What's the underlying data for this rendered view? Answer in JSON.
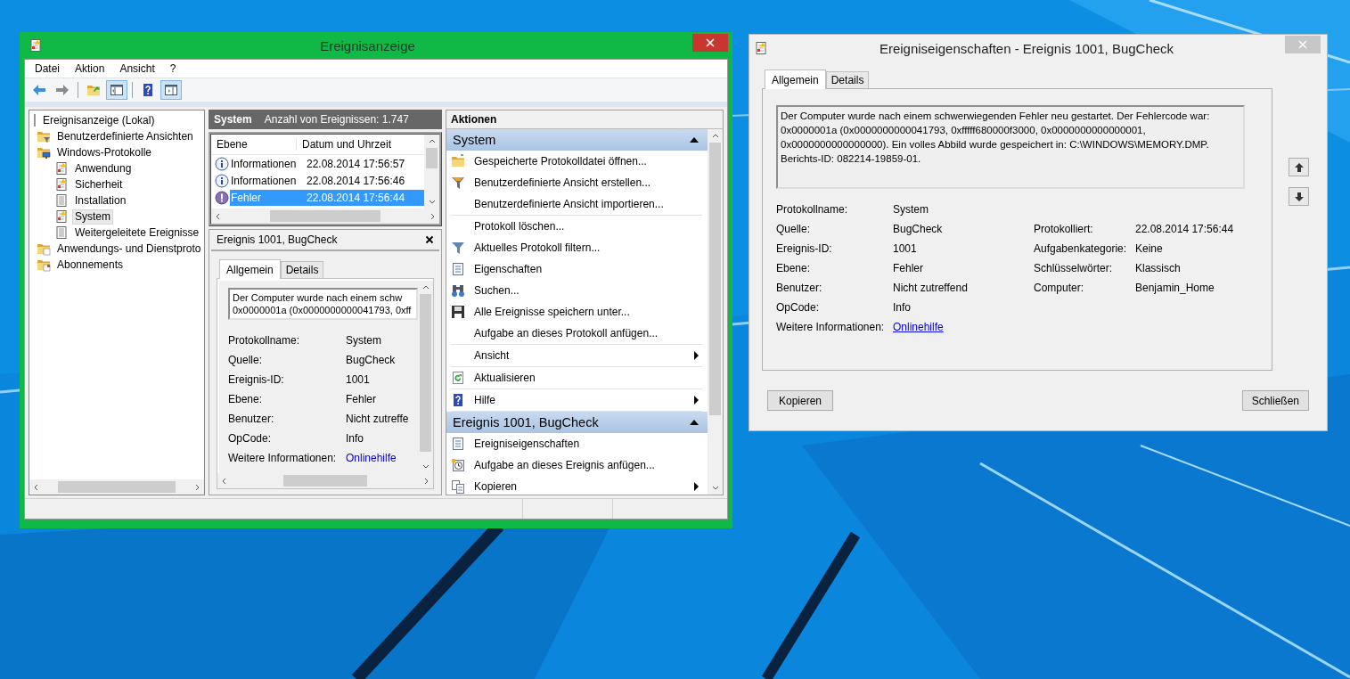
{
  "main_window": {
    "title": "Ereignisanzeige",
    "menu": [
      "Datei",
      "Aktion",
      "Ansicht",
      "?"
    ],
    "toolbar": [
      [
        {
          "kind": "back",
          "on": false
        },
        {
          "kind": "forward",
          "on": false
        }
      ],
      [
        {
          "kind": "up",
          "on": false
        },
        {
          "kind": "tree-toggle",
          "on": true
        }
      ],
      [
        {
          "kind": "help",
          "on": false
        },
        {
          "kind": "pane-toggle",
          "on": true
        }
      ]
    ],
    "tree": [
      {
        "label": "Ereignisanzeige (Lokal)",
        "kind": "root",
        "selected": false,
        "children": [
          {
            "label": "Benutzerdefinierte Ansichten",
            "kind": "filter-folder",
            "selected": false
          },
          {
            "label": "Windows-Protokolle",
            "kind": "pc-folder",
            "selected": false,
            "children": [
              {
                "label": "Anwendung",
                "kind": "log",
                "selected": false
              },
              {
                "label": "Sicherheit",
                "kind": "log",
                "selected": false
              },
              {
                "label": "Installation",
                "kind": "plain-log",
                "selected": false
              },
              {
                "label": "System",
                "kind": "log",
                "selected": true
              },
              {
                "label": "Weitergeleitete Ereignisse",
                "kind": "plain-log",
                "selected": false
              }
            ]
          },
          {
            "label": "Anwendungs- und Dienstproto",
            "kind": "app-folder",
            "selected": false
          },
          {
            "label": "Abonnements",
            "kind": "sub-folder",
            "selected": false
          }
        ]
      }
    ],
    "log_header": {
      "name": "System",
      "count": "Anzahl von Ereignissen: 1.747"
    },
    "events": {
      "columns": [
        "Ebene",
        "Datum und Uhrzeit"
      ],
      "rows": [
        {
          "kind": "info",
          "level": "Informationen",
          "date": "22.08.2014 17:56:57",
          "selected": false
        },
        {
          "kind": "info",
          "level": "Informationen",
          "date": "22.08.2014 17:56:46",
          "selected": false
        },
        {
          "kind": "error",
          "level": "Fehler",
          "date": "22.08.2014 17:56:44",
          "selected": true
        }
      ]
    },
    "detail": {
      "title": "Ereignis 1001, BugCheck",
      "tabs": [
        {
          "label": "Allgemein",
          "selected": true
        },
        {
          "label": "Details",
          "selected": false
        }
      ],
      "description": [
        "Der Computer wurde nach einem schw",
        "0x0000001a (0x0000000000041793, 0xff"
      ],
      "fields": [
        {
          "label": "Protokollname:",
          "value": "System",
          "kind": "text"
        },
        {
          "label": "Quelle:",
          "value": "BugCheck",
          "kind": "text"
        },
        {
          "label": "Ereignis-ID:",
          "value": "1001",
          "kind": "text"
        },
        {
          "label": "Ebene:",
          "value": "Fehler",
          "kind": "text"
        },
        {
          "label": "Benutzer:",
          "value": "Nicht zutreffe",
          "kind": "text"
        },
        {
          "label": "OpCode:",
          "value": "Info",
          "kind": "text"
        },
        {
          "label": "Weitere Informationen:",
          "value": "Onlinehilfe",
          "kind": "link"
        }
      ]
    },
    "actions": {
      "title": "Aktionen",
      "sections": [
        {
          "title": "System",
          "expanded": true,
          "groups": [
            [
              {
                "label": "Gespeicherte Protokolldatei öffnen...",
                "kind": "open-folder",
                "submenu": false
              },
              {
                "label": "Benutzerdefinierte Ansicht erstellen...",
                "kind": "funnel-star",
                "submenu": false
              },
              {
                "label": "Benutzerdefinierte Ansicht importieren...",
                "kind": "plain",
                "submenu": false
              }
            ],
            [
              {
                "label": "Protokoll löschen...",
                "kind": "plain",
                "submenu": false
              },
              {
                "label": "Aktuelles Protokoll filtern...",
                "kind": "funnel",
                "submenu": false
              },
              {
                "label": "Eigenschaften",
                "kind": "properties",
                "submenu": false
              },
              {
                "label": "Suchen...",
                "kind": "binoculars",
                "submenu": false
              },
              {
                "label": "Alle Ereignisse speichern unter...",
                "kind": "floppy",
                "submenu": false
              },
              {
                "label": "Aufgabe an dieses Protokoll anfügen...",
                "kind": "plain",
                "submenu": false
              }
            ],
            [
              {
                "label": "Ansicht",
                "kind": "plain",
                "submenu": true
              }
            ],
            [
              {
                "label": "Aktualisieren",
                "kind": "refresh",
                "submenu": false
              }
            ],
            [
              {
                "label": "Hilfe",
                "kind": "help",
                "submenu": true
              }
            ]
          ]
        },
        {
          "title": "Ereignis 1001, BugCheck",
          "expanded": true,
          "groups": [
            [
              {
                "label": "Ereigniseigenschaften",
                "kind": "properties",
                "submenu": false
              },
              {
                "label": "Aufgabe an dieses Ereignis anfügen...",
                "kind": "task",
                "submenu": false
              },
              {
                "label": "Kopieren",
                "kind": "copy",
                "submenu": true
              }
            ]
          ]
        }
      ]
    }
  },
  "dialog": {
    "title": "Ereigniseigenschaften - Ereignis 1001, BugCheck",
    "tabs": [
      {
        "label": "Allgemein",
        "selected": true
      },
      {
        "label": "Details",
        "selected": false
      }
    ],
    "description": "Der Computer wurde nach einem schwerwiegenden Fehler neu gestartet. Der Fehlercode war: 0x0000001a (0x0000000000041793, 0xfffff680000f3000, 0x0000000000000001, 0x0000000000000000). Ein volles Abbild wurde gespeichert in: C:\\WINDOWS\\MEMORY.DMP. Berichts-ID: 082214-19859-01.",
    "rows": [
      {
        "left": {
          "label": "Protokollname:",
          "value": "System",
          "kind": "text"
        }
      },
      {
        "left": {
          "label": "Quelle:",
          "value": "BugCheck",
          "kind": "text"
        },
        "right": {
          "label": "Protokolliert:",
          "value": "22.08.2014 17:56:44",
          "kind": "text"
        }
      },
      {
        "left": {
          "label": "Ereignis-ID:",
          "value": "1001",
          "kind": "text"
        },
        "right": {
          "label": "Aufgabenkategorie:",
          "value": "Keine",
          "kind": "text"
        }
      },
      {
        "left": {
          "label": "Ebene:",
          "value": "Fehler",
          "kind": "text"
        },
        "right": {
          "label": "Schlüsselwörter:",
          "value": "Klassisch",
          "kind": "text"
        }
      },
      {
        "left": {
          "label": "Benutzer:",
          "value": "Nicht zutreffend",
          "kind": "text"
        },
        "right": {
          "label": "Computer:",
          "value": "Benjamin_Home",
          "kind": "text"
        }
      },
      {
        "left": {
          "label": "OpCode:",
          "value": "Info",
          "kind": "text"
        }
      },
      {
        "left": {
          "label": "Weitere Informationen:",
          "value": "Onlinehilfe",
          "kind": "link"
        }
      }
    ],
    "buttons": [
      "Kopieren",
      "Schließen"
    ]
  }
}
